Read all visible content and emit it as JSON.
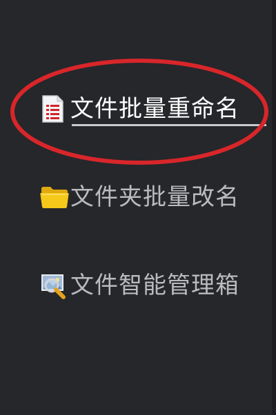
{
  "menu": {
    "items": [
      {
        "label": "文件批量重命名",
        "icon": "document-list-icon",
        "selected": true
      },
      {
        "label": "文件夹批量改名",
        "icon": "folder-icon",
        "selected": false
      },
      {
        "label": "文件智能管理箱",
        "icon": "magnifier-image-icon",
        "selected": false
      }
    ]
  },
  "colors": {
    "background": "#25272b",
    "highlight_ellipse": "#d8262a",
    "selected_text": "#ffffff",
    "text": "#b9bbbf",
    "folder": "#f2c216",
    "document_lines": "#d2222a"
  }
}
